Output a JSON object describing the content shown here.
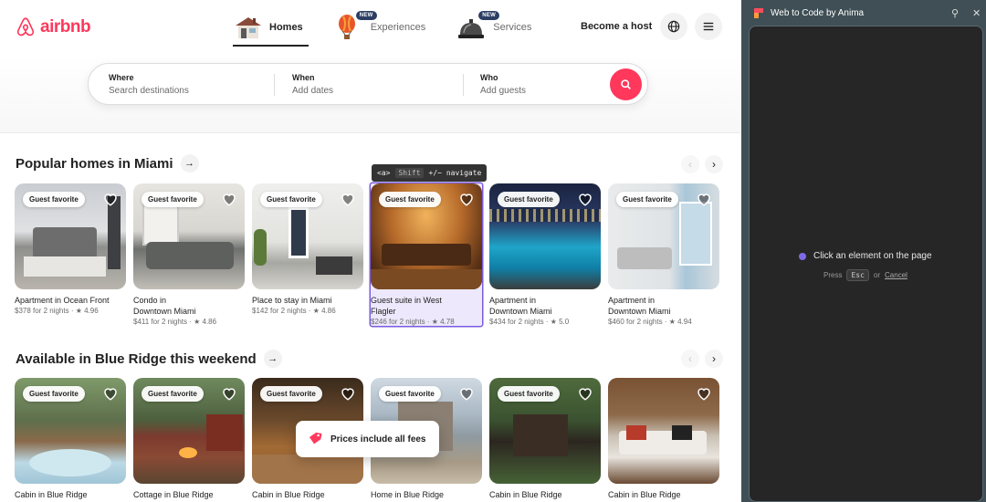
{
  "brand": {
    "name": "airbnb",
    "color": "#ff385c"
  },
  "nav": {
    "tabs": [
      {
        "label": "Homes",
        "icon": "house-icon",
        "active": true,
        "badge": ""
      },
      {
        "label": "Experiences",
        "icon": "hot-air-balloon-icon",
        "active": false,
        "badge": "NEW"
      },
      {
        "label": "Services",
        "icon": "service-bell-icon",
        "active": false,
        "badge": "NEW"
      }
    ],
    "host_link": "Become a host",
    "globe_icon": "globe-icon",
    "menu_icon": "menu-icon"
  },
  "search": {
    "where": {
      "label": "Where",
      "placeholder": "Search destinations"
    },
    "when": {
      "label": "When",
      "placeholder": "Add dates"
    },
    "who": {
      "label": "Who",
      "placeholder": "Add guests"
    },
    "button_icon": "search-icon"
  },
  "sections": [
    {
      "title": "Popular homes in Miami",
      "cards": [
        {
          "badge": "Guest favorite",
          "title": "Apartment in Ocean Front",
          "price": "$378 for 2 nights · ★ 4.96"
        },
        {
          "badge": "Guest favorite",
          "title": "Condo in Downtown Miami",
          "price": "$411 for 2 nights · ★ 4.86"
        },
        {
          "badge": "Guest favorite",
          "title": "Place to stay in Miami",
          "price": "$142 for 2 nights · ★ 4.86"
        },
        {
          "badge": "Guest favorite",
          "title": "Guest suite in West Flagler",
          "price": "$246 for 2 nights · ★ 4.78"
        },
        {
          "badge": "Guest favorite",
          "title": "Apartment in Downtown Miami",
          "price": "$434 for 2 nights · ★ 5.0"
        },
        {
          "badge": "Guest favorite",
          "title": "Apartment in Downtown Miami",
          "price": "$460 for 2 nights · ★ 4.94"
        }
      ]
    },
    {
      "title": "Available in Blue Ridge this weekend",
      "cards": [
        {
          "badge": "Guest favorite",
          "title": "Cabin in Blue Ridge",
          "price": ""
        },
        {
          "badge": "Guest favorite",
          "title": "Cottage in Blue Ridge",
          "price": ""
        },
        {
          "badge": "Guest favorite",
          "title": "Cabin in Blue Ridge",
          "price": ""
        },
        {
          "badge": "Guest favorite",
          "title": "Home in Blue Ridge",
          "price": ""
        },
        {
          "badge": "Guest favorite",
          "title": "Cabin in Blue Ridge",
          "price": ""
        },
        {
          "badge": "",
          "title": "Cabin in Blue Ridge",
          "price": ""
        }
      ]
    }
  ],
  "tooltip": {
    "tag": "<a>",
    "key": "Shift",
    "hint": "+/− navigate"
  },
  "toast": {
    "text": "Prices include all fees",
    "icon": "price-tag-icon"
  },
  "panel": {
    "title": "Web to Code by Anima",
    "pin_icon": "pin-icon",
    "close_icon": "close-icon",
    "prompt": "Click an element on the page",
    "press": "Press",
    "key": "Esc",
    "or": "or",
    "cancel": "Cancel"
  }
}
